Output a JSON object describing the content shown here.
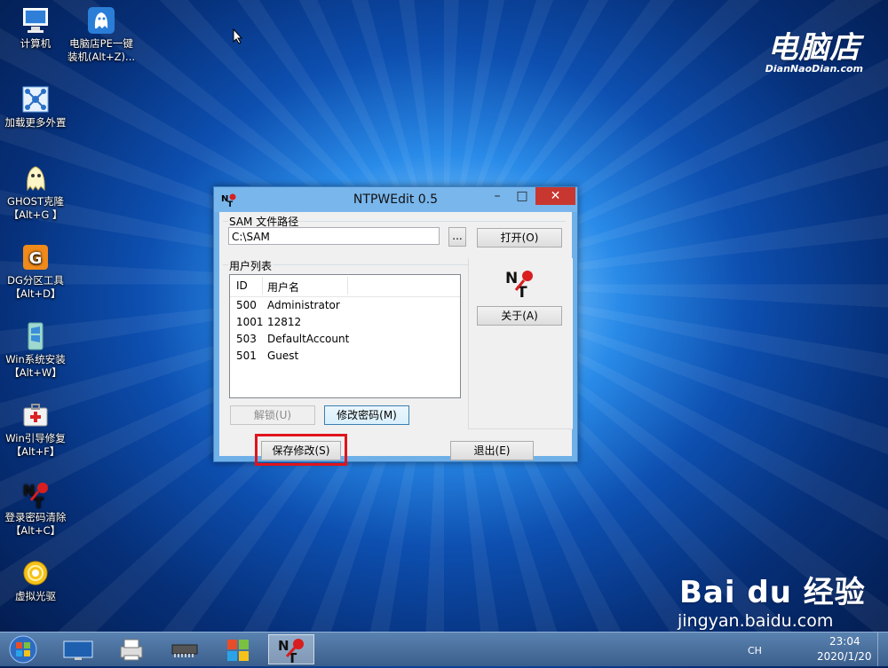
{
  "desktop": {
    "icons": [
      {
        "label": "计算机",
        "icon": "computer-icon"
      },
      {
        "label": "电脑店PE一键\n装机(Alt+Z)...",
        "icon": "ghost-installer-icon"
      },
      {
        "label": "加载更多外置",
        "icon": "network-load-icon"
      },
      {
        "label": "GHOST克隆\n【Alt+G 】",
        "icon": "ghost-icon"
      },
      {
        "label": "DG分区工具\n【Alt+D】",
        "icon": "diskgenius-icon"
      },
      {
        "label": "Win系统安装\n【Alt+W】",
        "icon": "win-install-icon"
      },
      {
        "label": "Win引导修复\n【Alt+F】",
        "icon": "repair-kit-icon"
      },
      {
        "label": "登录密码清除\n【Alt+C】",
        "icon": "ntpw-key-icon"
      },
      {
        "label": "虚拟光驱",
        "icon": "virtual-cd-icon"
      }
    ],
    "brand": {
      "name": "电脑店",
      "domain": "DianNaoDian.com"
    },
    "watermark": {
      "logo": "Bai du 经验",
      "url": "jingyan.baidu.com"
    }
  },
  "window": {
    "title": "NTPWEdit 0.5",
    "sam_group_label": "SAM 文件路径",
    "sam_path": "C:\\SAM",
    "browse_label": "...",
    "open_label": "打开(O)",
    "users_group_label": "用户列表",
    "columns": [
      "ID",
      "用户名"
    ],
    "users": [
      {
        "id": "500",
        "name": "Administrator"
      },
      {
        "id": "1001",
        "name": "12812"
      },
      {
        "id": "503",
        "name": "DefaultAccount"
      },
      {
        "id": "501",
        "name": "Guest"
      }
    ],
    "about_label": "关于(A)",
    "unlock_label": "解锁(U)",
    "change_password_label": "修改密码(M)",
    "save_label": "保存修改(S)",
    "exit_label": "退出(E)"
  },
  "taskbar": {
    "items": [
      "start-orb-icon",
      "screen-icon",
      "printer-icon",
      "memory-chip-icon",
      "puzzle-icon",
      "ntpw-key-icon"
    ],
    "lang": "CH",
    "time": "23:04",
    "date": "2020/1/20"
  }
}
